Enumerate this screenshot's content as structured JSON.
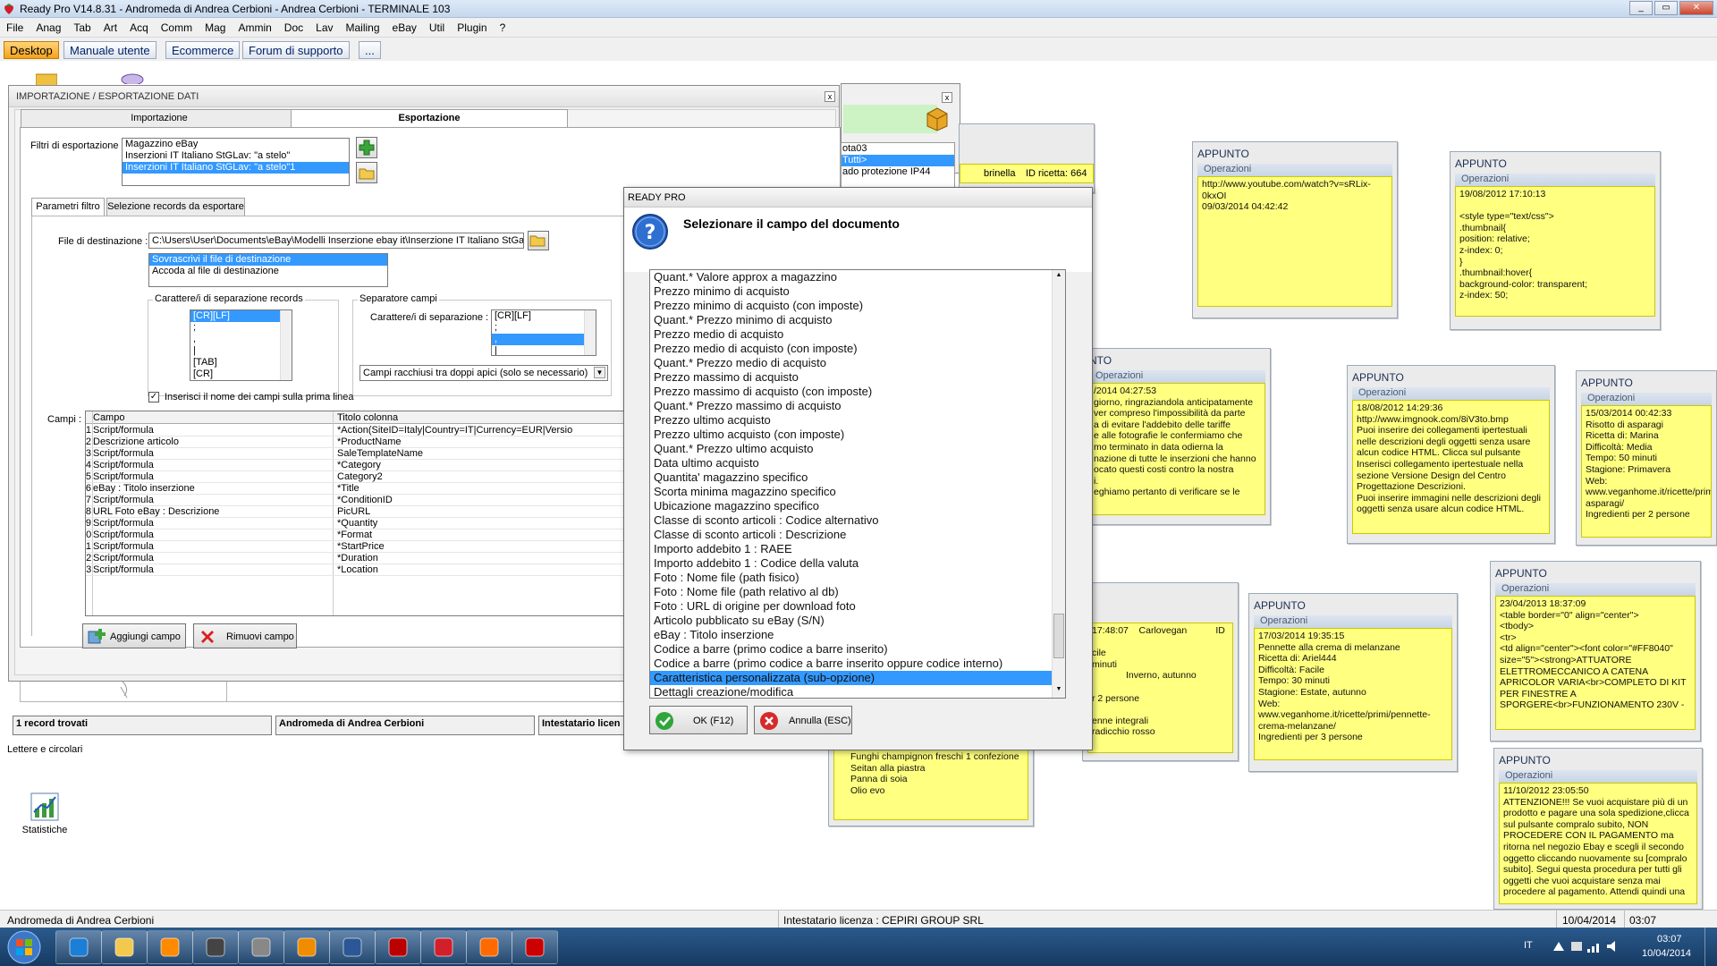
{
  "window": {
    "title": "Ready Pro V14.8.31 - Andromeda di Andrea Cerbioni - Andrea Cerbioni - TERMINALE 103"
  },
  "menu": [
    "File",
    "Anag",
    "Tab",
    "Art",
    "Acq",
    "Comm",
    "Mag",
    "Ammin",
    "Doc",
    "Lav",
    "Mailing",
    "eBay",
    "Util",
    "Plugin",
    "?"
  ],
  "shortcuts": [
    "Desktop",
    "Manuale utente",
    "Ecommerce",
    "Forum di supporto",
    "..."
  ],
  "desktop_icons": {
    "lettere": "Lettere e circolari",
    "statistiche": "Statistiche"
  },
  "import_export": {
    "title": "IMPORTAZIONE / ESPORTAZIONE DATI",
    "tabs": [
      "Importazione",
      "Esportazione"
    ],
    "filters_label": "Filtri di esportazione :",
    "filters": [
      "Magazzino eBay",
      "Inserzioni IT Italiano StGLav: \"a stelo\"",
      "Inserzioni IT Italiano StGLav: \"a stelo\"1"
    ],
    "subtabs": [
      "Parametri filtro",
      "Selezione records da esportare"
    ],
    "dest_label": "File di destinazione :",
    "dest_value": "C:\\Users\\User\\Documents\\eBay\\Modelli Inserzione ebay it\\Inserzione IT Italiano StGa",
    "dest_modes": [
      "Sovrascrivi il file di destinazione",
      "Accoda al file di destinazione"
    ],
    "rec_sep_group": "Carattere/i di separazione records",
    "rec_sep_items": [
      "[CR][LF]",
      ";",
      ",",
      "|",
      "[TAB]",
      "[CR]"
    ],
    "field_sep_group": "Separatore campi",
    "field_sep_label": "Carattere/i di separazione :",
    "field_sep_items": [
      "[CR][LF]",
      ";",
      ",",
      "|"
    ],
    "quote_mode": "Campi racchiusi tra doppi apici (solo se necessario)",
    "header_checkbox": "Inserisci il nome dei campi sulla prima linea",
    "fields_label": "Campi :",
    "col_campo": "Campo",
    "col_titolo": "Titolo colonna",
    "rows": [
      {
        "n": "1",
        "campo": "Script/formula",
        "titolo": "*Action(SiteID=Italy|Country=IT|Currency=EUR|Versio"
      },
      {
        "n": "2",
        "campo": "Descrizione articolo",
        "titolo": "*ProductName"
      },
      {
        "n": "3",
        "campo": "Script/formula",
        "titolo": "SaleTemplateName"
      },
      {
        "n": "4",
        "campo": "Script/formula",
        "titolo": "*Category"
      },
      {
        "n": "5",
        "campo": "Script/formula",
        "titolo": "Category2"
      },
      {
        "n": "6",
        "campo": "eBay : Titolo inserzione",
        "titolo": "*Title"
      },
      {
        "n": "7",
        "campo": "Script/formula",
        "titolo": "*ConditionID"
      },
      {
        "n": "8",
        "campo": "URL Foto eBay : Descrizione",
        "titolo": "PicURL"
      },
      {
        "n": "9",
        "campo": "Script/formula",
        "titolo": "*Quantity"
      },
      {
        "n": "10",
        "campo": "Script/formula",
        "titolo": "*Format"
      },
      {
        "n": "11",
        "campo": "Script/formula",
        "titolo": "*StartPrice"
      },
      {
        "n": "12",
        "campo": "Script/formula",
        "titolo": "*Duration"
      },
      {
        "n": "13",
        "campo": "Script/formula",
        "titolo": "*Location"
      }
    ],
    "add_btn": "Aggiungi campo",
    "remove_btn": "Rimuovi campo"
  },
  "back_panel": {
    "status_records": "1 record trovati",
    "status_company": "Andromeda di Andrea Cerbioni",
    "status_license": "Intestatario licen"
  },
  "recipe_window": {
    "list": [
      "ota03",
      "Tutti>",
      "ado protezione IP44"
    ],
    "row_name": "brinella",
    "row_id": "ID ricetta: 664"
  },
  "dialog": {
    "title": "READY PRO",
    "prompt": "Selezionare il campo del documento",
    "items": [
      "Quant.* Valore approx a magazzino",
      "Prezzo minimo di acquisto",
      "Prezzo minimo di acquisto (con imposte)",
      "Quant.* Prezzo minimo di acquisto",
      "Prezzo medio di acquisto",
      "Prezzo medio di acquisto (con imposte)",
      "Quant.* Prezzo medio di acquisto",
      "Prezzo massimo di acquisto",
      "Prezzo massimo di acquisto (con imposte)",
      "Quant.* Prezzo massimo di acquisto",
      "Prezzo ultimo acquisto",
      "Prezzo ultimo acquisto (con imposte)",
      "Quant.* Prezzo ultimo acquisto",
      "Data ultimo acquisto",
      "Quantita' magazzino specifico",
      "Scorta minima magazzino specifico",
      "Ubicazione magazzino specifico",
      "Classe di sconto articoli : Codice alternativo",
      "Classe di sconto articoli : Descrizione",
      "Importo addebito 1 : RAEE",
      "Importo addebito 1 : Codice della valuta",
      "Foto : Nome file (path fisico)",
      "Foto : Nome file (path relativo al db)",
      "Foto : URL di origine per download foto",
      "Articolo pubblicato su eBay (S/N)",
      "eBay : Titolo inserzione",
      "Codice a barre (primo codice a barre inserito)",
      "Codice a barre (primo codice a barre inserito oppure codice interno)",
      "Caratteristica personalizzata (sub-opzione)",
      "Dettagli creazione/modifica"
    ],
    "selected_index": 28,
    "ok": "OK (F12)",
    "cancel": "Annulla (ESC)"
  },
  "notes": {
    "header": "APPUNTO",
    "op": "Operazioni",
    "n1": "http://www.youtube.com/watch?v=sRLix-\n0kxOI\n09/03/2014 04:42:42",
    "n2": "19/08/2012 17:10:13\n\n<style type=\"text/css\">\n.thumbnail{\nposition: relative;\nz-index: 0;\n}\n.thumbnail:hover{\nbackground-color: transparent;\nz-index: 50;",
    "n3_head": "NTO",
    "n3": "/2014 04:27:53\ngiorno, ringraziandola anticipatamente\nver compreso l'impossibilità da parte\na di evitare l'addebito delle tariffe\ne alle fotografie le confermiamo che\nmo terminato in data odierna la\nnazione di tutte le inserzioni che hanno\nocato questi costi contro la nostra\ni.\neghiamo pertanto di verificare se le",
    "n4": "18/08/2012 14:29:36\nhttp://www.imgnook.com/8iV3to.bmp\nPuoi inserire dei collegamenti ipertestuali\nnelle descrizioni degli oggetti senza usare\nalcun codice HTML. Clicca sul pulsante\nInserisci collegamento ipertestuale nella\nsezione Versione Design del Centro\nProgettazione Descrizioni.\nPuoi inserire immagini nelle descrizioni degli\noggetti senza usare alcun codice HTML.",
    "n5": "15/03/2014 00:42:33\nRisotto di asparagi\nRicetta di: Marina\nDifficoltà: Media\nTempo: 50 minuti\nStagione: Primavera\nWeb:\nwww.veganhome.it/ricette/prim\nasparagi/\nIngredienti per 2 persone",
    "n6": "17/03/2014 19:35:15\nPennette alla crema di melanzane\nRicetta di: Ariel444\nDifficoltà: Facile\nTempo: 30 minuti\nStagione: Estate, autunno\nWeb:\nwww.veganhome.it/ricette/primi/pennette-\ncrema-melanzane/\nIngredienti per 3 persone",
    "n7": "23/04/2013 18:37:09\n<table border=\"0\" align=\"center\">\n<tbody>\n<tr>\n<td align=\"center\"><font color=\"#FF8040\"\nsize=\"5\"><strong>ATTUATORE\nELETTROMECCANICO A CATENA\nAPRICOLOR VARIA<br>COMPLETO DI KIT\nPER FINESTRE A\nSPORGERE<br>FUNZIONAMENTO 230V -",
    "n8": "11/10/2012 23:05:50\nATTENZIONE!!! Se vuoi acquistare più di un\nprodotto e pagare una sola spedizione,clicca\nsul pulsante compralo subito, NON\nPROCEDERE CON IL PAGAMENTO ma\nritorna nel negozio Ebay e scegli il secondo\noggetto cliccando nuovamente su [compralo\nsubito]. Segui questa procedura per tutti gli\noggetti che vuoi acquistare senza mai\nprocedere al pagamento. Attendi quindi una",
    "n9": "17:48:07    Carlovegan           ID\n\ncile\nminuti\n             Inverno, autunno\n\nr 2 persone\n\nenne integrali\nradicchio rosso",
    "n10": "Funghi champignon freschi 1 confezione\nSeitan alla piastra\nPanna di soia\nOlio evo"
  },
  "status": {
    "company": "Andromeda di Andrea Cerbioni",
    "license": "Intestatario licenza : CEPIRI GROUP SRL",
    "date": "10/04/2014",
    "time": "03:07"
  },
  "taskbar": {
    "lang": "IT",
    "time": "03:07",
    "date": "10/04/2014",
    "apps": [
      "ie-icon",
      "explorer-icon",
      "media-player-icon",
      "3cx-icon",
      "gimp-icon",
      "outlook-icon",
      "word-icon",
      "filezilla-icon",
      "ready-pro-icon",
      "firefox-icon",
      "acrobat-icon"
    ]
  }
}
